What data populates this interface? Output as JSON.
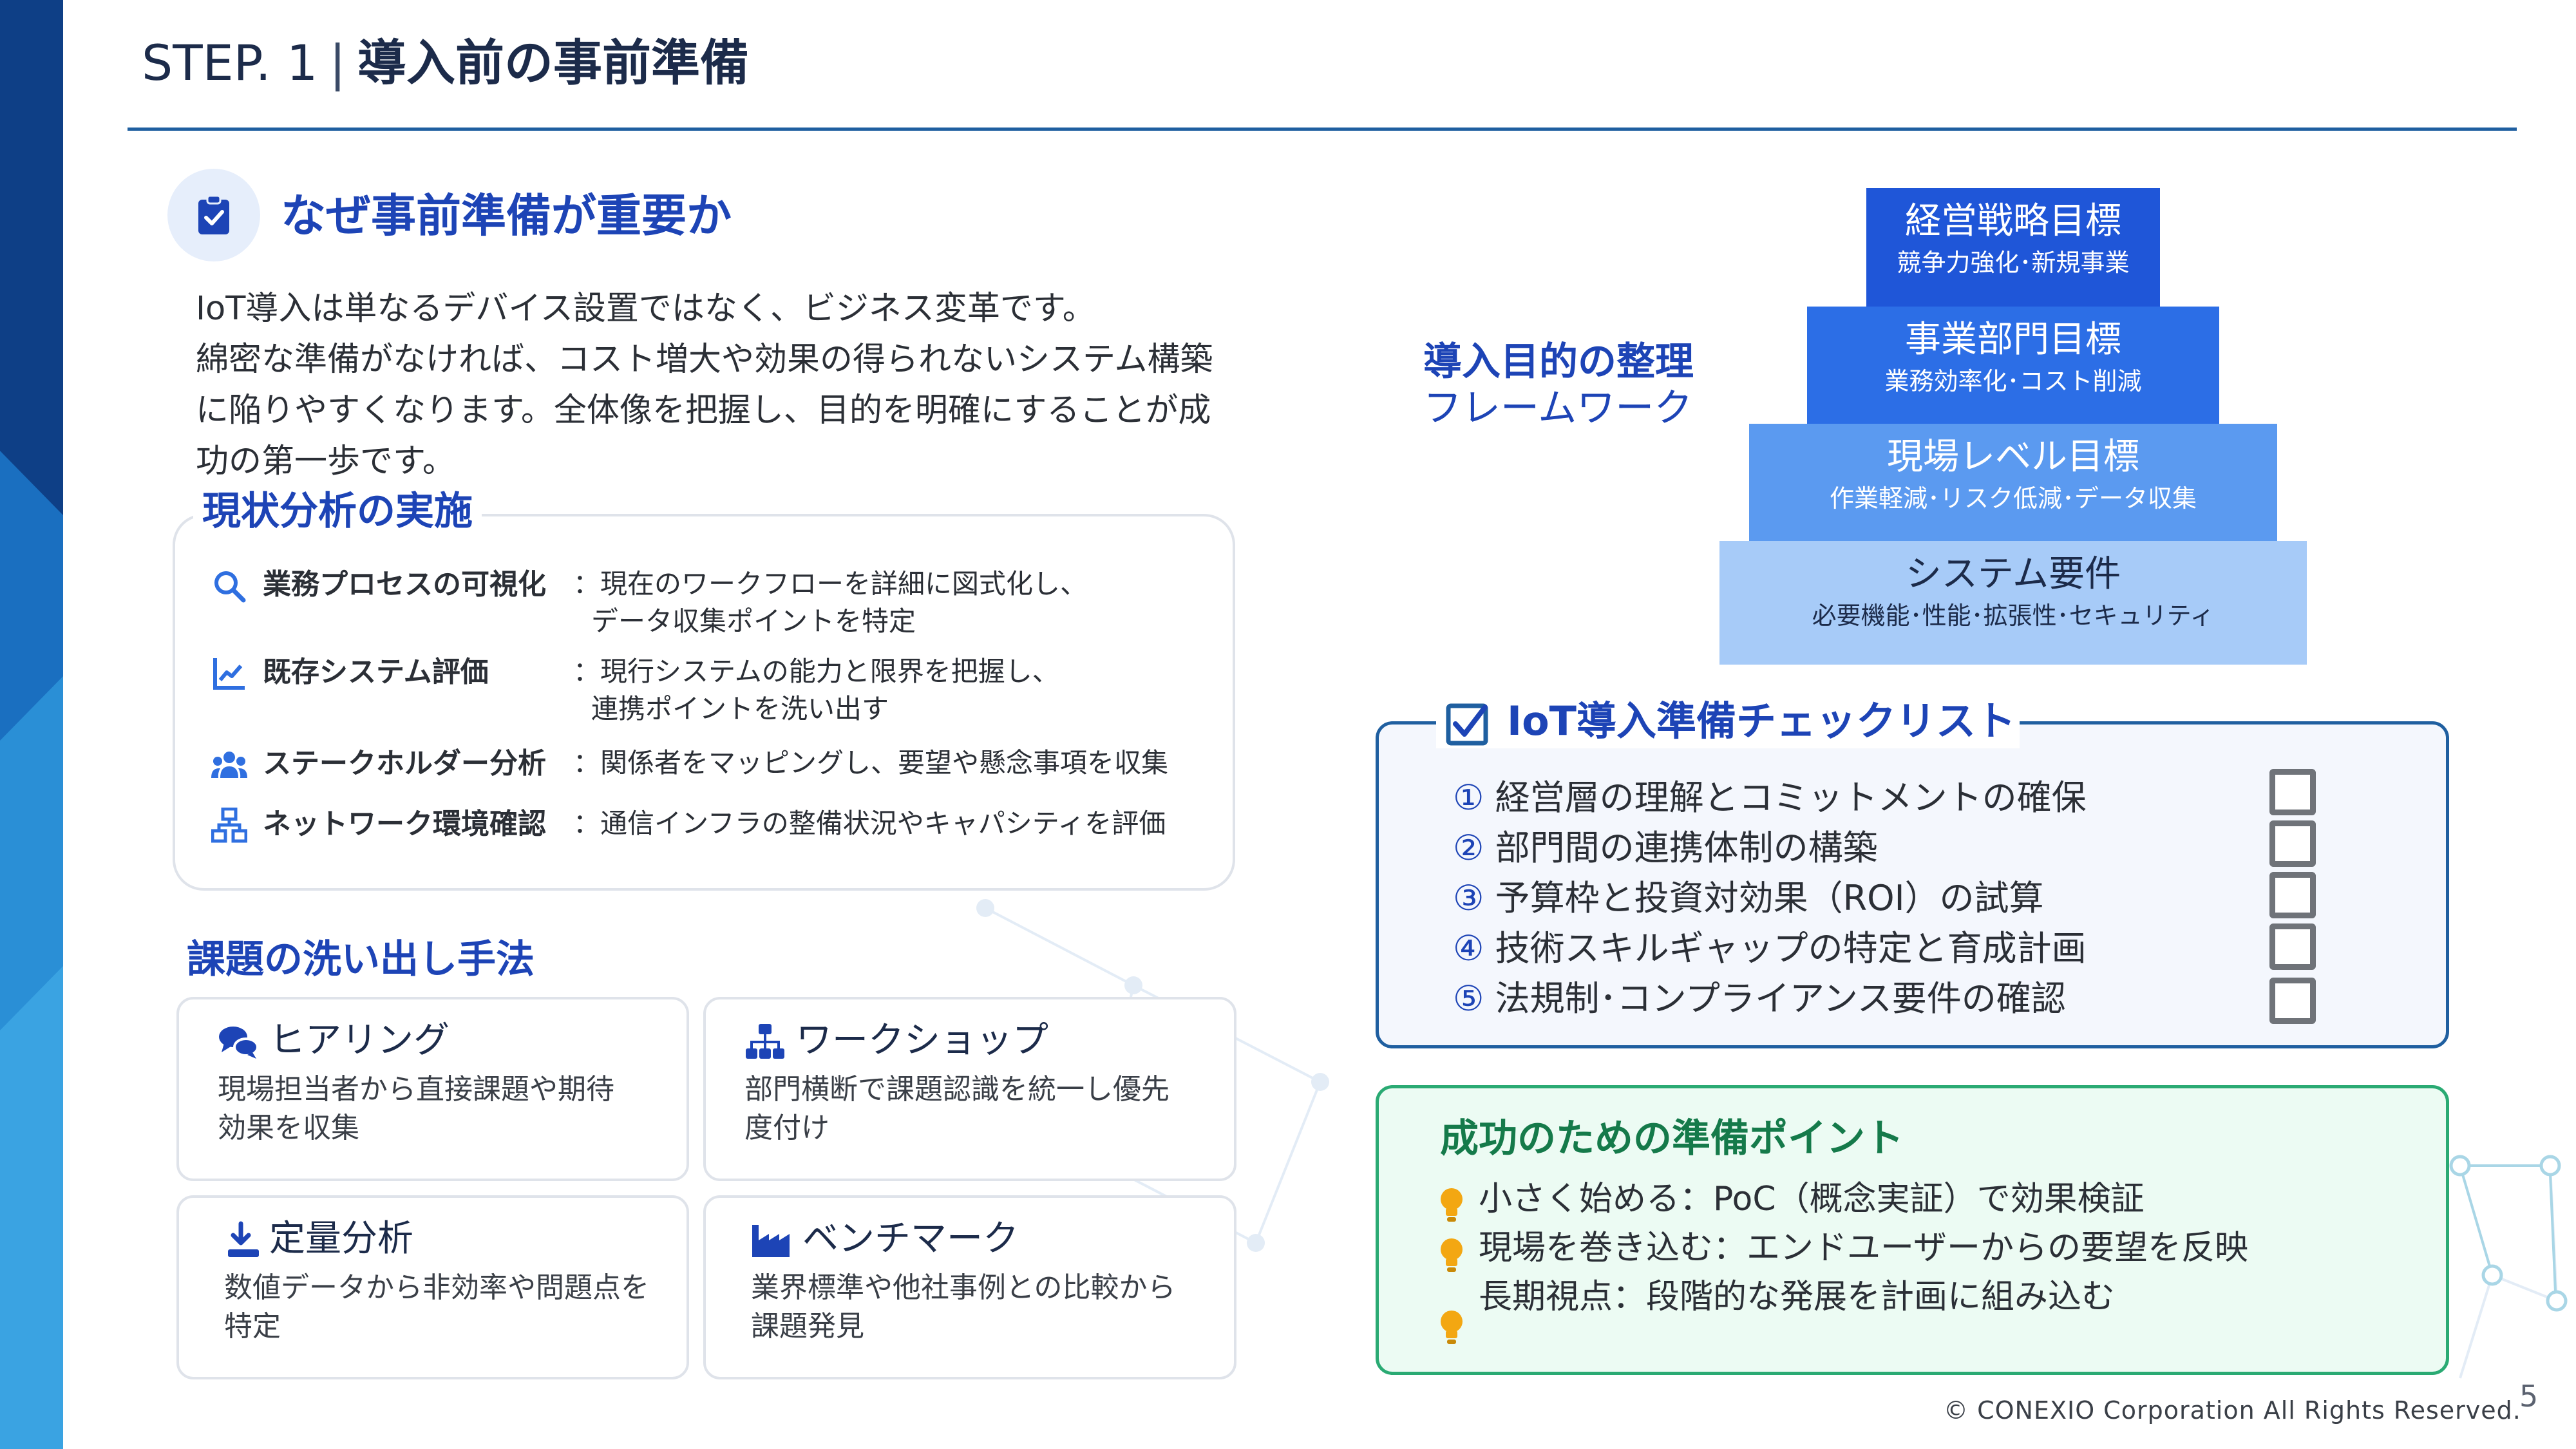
{
  "header": {
    "step": "STEP. 1",
    "separator": "|",
    "title": "導入前の事前準備"
  },
  "why": {
    "icon": "clipboard-check-icon",
    "title": "なぜ事前準備が重要か",
    "lines": [
      "IoT導入は単なるデバイス設置ではなく、ビジネス変革です。",
      "綿密な準備がなければ、コスト増大や効果の得られないシステム構築",
      "に陥りやすくなります。全体像を把握し、目的を明確にすることが成",
      "功の第一歩です。"
    ]
  },
  "analysis": {
    "title": "現状分析の実施",
    "items": [
      {
        "icon": "search-icon",
        "label": "業務プロセスの可視化",
        "desc1": "：現在のワークフローを詳細に図式化し、",
        "desc2": "データ収集ポイントを特定"
      },
      {
        "icon": "line-chart-icon",
        "label": "既存システム評価",
        "desc1": "：現行システムの能力と限界を把握し、",
        "desc2": "連携ポイントを洗い出す"
      },
      {
        "icon": "users-icon",
        "label": "ステークホルダー分析",
        "desc1": "：関係者をマッピングし、要望や懸念事項を収集",
        "desc2": ""
      },
      {
        "icon": "network-icon",
        "label": "ネットワーク環境確認",
        "desc1": "：通信インフラの整備状況やキャパシティを評価",
        "desc2": ""
      }
    ]
  },
  "issues": {
    "title": "課題の洗い出し手法",
    "cards": [
      {
        "icon": "chat-bubbles-icon",
        "title": "ヒアリング",
        "line1": "現場担当者から直接課題や期待",
        "line2": "効果を収集"
      },
      {
        "icon": "sitemap-icon",
        "title": "ワークショップ",
        "line1": "部門横断で課題認識を統一し優先",
        "line2": "度付け"
      },
      {
        "icon": "download-icon",
        "title": "定量分析",
        "line1": "数値データから非効率や問題点を",
        "line2": "特定"
      },
      {
        "icon": "industry-icon",
        "title": "ベンチマーク",
        "line1": "業界標準や他社事例との比較から",
        "line2": "課題発見"
      }
    ]
  },
  "pyramid": {
    "label_line1": "導入目的の整理",
    "label_line2": "フレームワーク",
    "tiers": [
      {
        "title": "経営戦略目標",
        "sub": "競争力強化･新規事業",
        "color": "#1f56d8",
        "text": "#ffffff"
      },
      {
        "title": "事業部門目標",
        "sub": "業務効率化･コスト削減",
        "color": "#2c6ee6",
        "text": "#ffffff"
      },
      {
        "title": "現場レベル目標",
        "sub": "作業軽減･リスク低減･データ収集",
        "color": "#5b9af0",
        "text": "#ffffff"
      },
      {
        "title": "システム要件",
        "sub": "必要機能･性能･拡張性･セキュリティ",
        "color": "#a7cbf8",
        "text": "#1c2b4a"
      }
    ]
  },
  "checklist": {
    "icon": "checkbox-checked-icon",
    "title": "IoT導入準備チェックリスト",
    "items": [
      {
        "num": "①",
        "text": "経営層の理解とコミットメントの確保"
      },
      {
        "num": "②",
        "text": "部門間の連携体制の構築"
      },
      {
        "num": "③",
        "text": "予算枠と投資対効果（ROI）の試算"
      },
      {
        "num": "④",
        "text": "技術スキルギャップの特定と育成計画"
      },
      {
        "num": "⑤",
        "text": "法規制･コンプライアンス要件の確認"
      }
    ]
  },
  "success": {
    "title": "成功のための準備ポイント",
    "icon": "lightbulb-icon",
    "items": [
      "小さく始める：PoC（概念実証）で効果検証",
      "現場を巻き込む：エンドユーザーからの要望を反映",
      "長期視点：段階的な発展を計画に組み込む"
    ]
  },
  "footer": {
    "copyright": "© CONEXIO Corporation All Rights Reserved.",
    "page": "5"
  },
  "colors": {
    "accent": "#1d44b6",
    "rule": "#1f5fa0",
    "success": "#2aaa73"
  }
}
